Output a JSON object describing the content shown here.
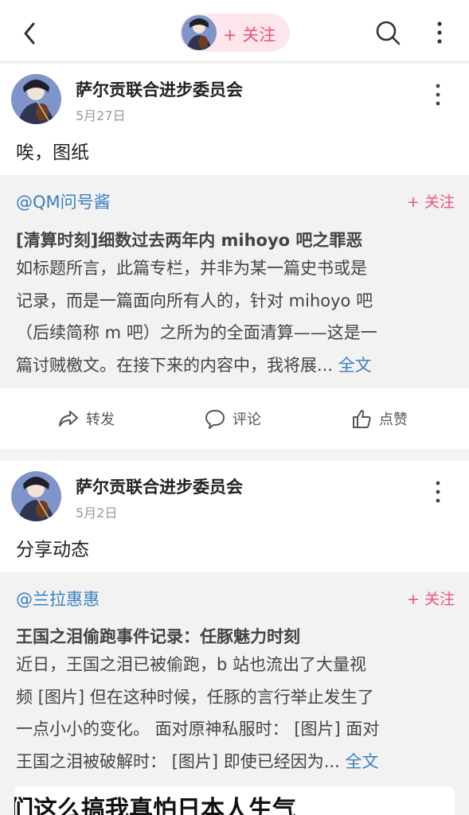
{
  "top": {
    "status_cut": "",
    "follow_label": "+ 关注",
    "icons": [
      "back-icon",
      "search-icon",
      "more-icon"
    ]
  },
  "posts": [
    {
      "author": "萨尔贡联合进步委员会",
      "date": "5月27日",
      "text": "唉，图纸",
      "quote": {
        "author": "@QM问号酱",
        "follow": "+ 关注",
        "title": "[清算时刻]细数过去两年内 mihoyo 吧之罪恶",
        "lines": [
          "如标题所言，此篇专栏，并非为某一篇史书或是",
          "记录，而是一篇面向所有人的，针对 mihoyo 吧",
          "（后续简称 m 吧）之所为的全面清算——这是一",
          "篇讨贼檄文。在接下来的内容中，我将展..."
        ],
        "more": "全文"
      },
      "actions": {
        "forward": "转发",
        "comment": "评论",
        "like": "点赞"
      }
    },
    {
      "author": "萨尔贡联合进步委员会",
      "date": "5月2日",
      "text": "分享动态",
      "quote": {
        "author": "@兰拉惠惠",
        "follow": "+ 关注",
        "title": "王国之泪偷跑事件记录：任豚魅力时刻",
        "lines": [
          "近日，王国之泪已被偷跑，b 站也流出了大量视",
          "频 [图片] 但在这种时候，任豚的言行举止发生了",
          "一点小小的变化。 面对原神私服时： [图片] 面对",
          "王国之泪被破解时： [图片] 即使已经因为..."
        ],
        "more": "全文"
      }
    }
  ],
  "bottom_card_text": "们这么搞我真怕日本人生气",
  "colors": {
    "accent_pink": "#f0507a",
    "link_blue": "#3a7fc0",
    "quote_bg": "#f2f2f2"
  }
}
